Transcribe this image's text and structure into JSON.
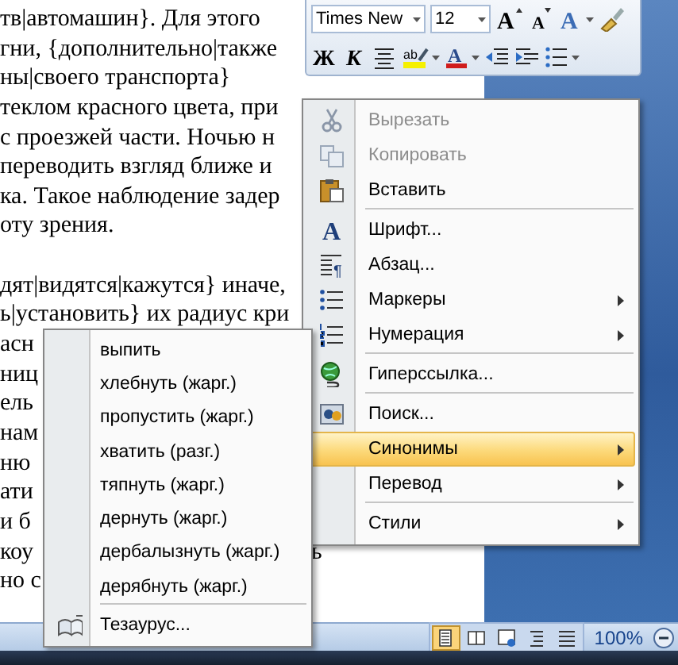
{
  "document": {
    "paragraphs": [
      {
        "lines": [
          {
            "text": "тв|автомашин}. Для этого"
          },
          {
            "text": "гни, {дополнительно|также"
          },
          {
            "text": "ны|своего транспорта}"
          },
          {
            "text": "теклом красного цвета, при"
          },
          {
            "text": "с проезжей части. Ночью н"
          },
          {
            "text": "переводить взгляд ближе и"
          },
          {
            "text": "ка. Такое наблюдение задер"
          },
          {
            "text": "оту зрения."
          }
        ]
      },
      {
        "lines": [
          {
            "text": "дят|видятся|кажутся} иначе,"
          },
          {
            "text": "ь|установить} их радиус кри"
          },
          {
            "text": "асн"
          },
          {
            "text": "ниц"
          },
          {
            "text": "ель"
          },
          {
            "text": "нам"
          },
          {
            "text": "ню"
          },
          {
            "text": "ати"
          },
          {
            "text": "и б"
          },
          {
            "text": "коу",
            "tail": "ь"
          },
          {
            "text": "но с"
          }
        ]
      }
    ]
  },
  "mini_toolbar": {
    "font": "Times New",
    "size": "12",
    "grow_font": "A",
    "shrink_font": "A",
    "text_style": "A",
    "bold": "Ж",
    "italic": "К",
    "highlight": "ab",
    "font_color": "A"
  },
  "context_menu": {
    "items": [
      {
        "label": "Вырезать",
        "disabled": true,
        "selected": false,
        "submenu": false,
        "separator_after": false
      },
      {
        "label": "Копировать",
        "disabled": true,
        "selected": false,
        "submenu": false,
        "separator_after": false
      },
      {
        "label": "Вставить",
        "disabled": false,
        "selected": false,
        "submenu": false,
        "separator_after": true
      },
      {
        "label": "Шрифт...",
        "glyph": "A",
        "disabled": false,
        "selected": false,
        "submenu": false,
        "separator_after": false
      },
      {
        "label": "Абзац...",
        "glyph": "¶",
        "disabled": false,
        "selected": false,
        "submenu": false,
        "separator_after": false
      },
      {
        "label": "Маркеры",
        "disabled": false,
        "selected": false,
        "submenu": true,
        "separator_after": false
      },
      {
        "label": "Нумерация",
        "disabled": false,
        "selected": false,
        "submenu": true,
        "separator_after": true
      },
      {
        "label": "Гиперссылка...",
        "disabled": false,
        "selected": false,
        "submenu": false,
        "separator_after": true
      },
      {
        "label": "Поиск...",
        "disabled": false,
        "selected": false,
        "submenu": false,
        "separator_after": false
      },
      {
        "label": "Синонимы",
        "disabled": false,
        "selected": true,
        "submenu": true,
        "separator_after": false
      },
      {
        "label": "Перевод",
        "disabled": false,
        "selected": false,
        "submenu": true,
        "separator_after": true
      },
      {
        "label": "Стили",
        "disabled": false,
        "selected": false,
        "submenu": true,
        "separator_after": false
      }
    ]
  },
  "synonyms_menu": {
    "items": [
      {
        "label": "выпить",
        "selected": false,
        "separator_after": false
      },
      {
        "label": "хлебнуть (жарг.)",
        "selected": false,
        "separator_after": false
      },
      {
        "label": "пропустить (жарг.)",
        "selected": false,
        "separator_after": false
      },
      {
        "label": "хватить (разг.)",
        "selected": false,
        "separator_after": false
      },
      {
        "label": "тяпнуть (жарг.)",
        "selected": false,
        "separator_after": false
      },
      {
        "label": "дернуть (жарг.)",
        "selected": false,
        "separator_after": false
      },
      {
        "label": "дербалызнуть (жарг.)",
        "selected": false,
        "separator_after": false
      },
      {
        "label": "дерябнуть (жарг.)",
        "selected": false,
        "separator_after": true
      },
      {
        "label": "Тезаурус...",
        "selected": false,
        "separator_after": false
      }
    ]
  },
  "status_bar": {
    "views": [
      {
        "selected": true
      },
      {
        "selected": false
      },
      {
        "selected": false
      },
      {
        "selected": false
      },
      {
        "selected": false
      }
    ],
    "zoom": "100%"
  }
}
